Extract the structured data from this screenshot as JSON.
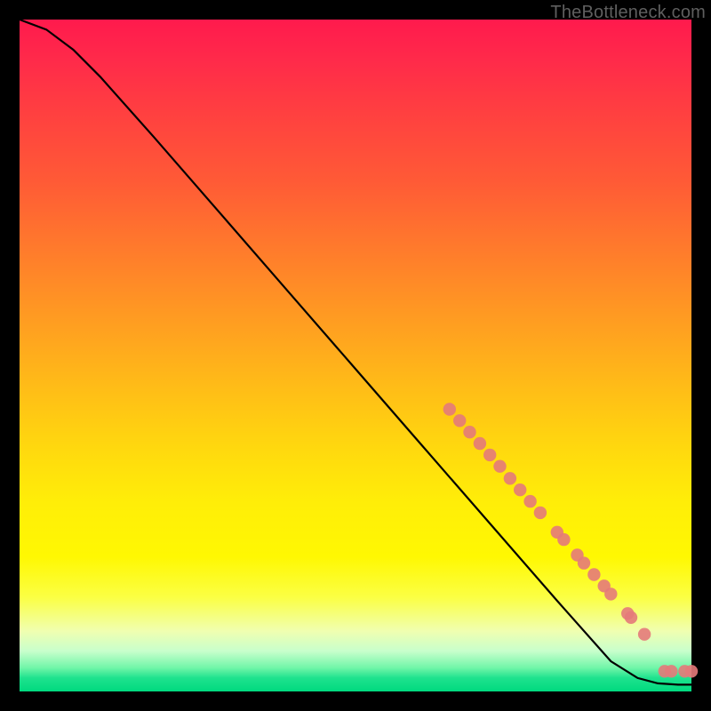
{
  "watermark": "TheBottleneck.com",
  "colors": {
    "curve_stroke": "#000000",
    "point_fill": "#e47a7a",
    "background": "#000000"
  },
  "chart_data": {
    "type": "line",
    "title": "",
    "xlabel": "",
    "ylabel": "",
    "xlim": [
      0,
      100
    ],
    "ylim": [
      0,
      100
    ],
    "grid": false,
    "legend": false,
    "curve": [
      {
        "x": 0,
        "y": 100
      },
      {
        "x": 4,
        "y": 98.5
      },
      {
        "x": 8,
        "y": 95.5
      },
      {
        "x": 12,
        "y": 91.5
      },
      {
        "x": 20,
        "y": 82.5
      },
      {
        "x": 30,
        "y": 71.0
      },
      {
        "x": 40,
        "y": 59.5
      },
      {
        "x": 50,
        "y": 48.0
      },
      {
        "x": 60,
        "y": 36.5
      },
      {
        "x": 70,
        "y": 25.0
      },
      {
        "x": 80,
        "y": 13.5
      },
      {
        "x": 88,
        "y": 4.5
      },
      {
        "x": 92,
        "y": 2.0
      },
      {
        "x": 95,
        "y": 1.2
      },
      {
        "x": 98,
        "y": 1.0
      },
      {
        "x": 100,
        "y": 1.0
      }
    ],
    "points": [
      {
        "x": 64.0,
        "y": 42.0
      },
      {
        "x": 65.5,
        "y": 40.3
      },
      {
        "x": 67.0,
        "y": 38.6
      },
      {
        "x": 68.5,
        "y": 36.9
      },
      {
        "x": 70.0,
        "y": 35.2
      },
      {
        "x": 71.5,
        "y": 33.5
      },
      {
        "x": 73.0,
        "y": 31.7
      },
      {
        "x": 74.5,
        "y": 30.0
      },
      {
        "x": 76.0,
        "y": 28.3
      },
      {
        "x": 77.5,
        "y": 26.6
      },
      {
        "x": 80.0,
        "y": 23.7
      },
      {
        "x": 81.0,
        "y": 22.6
      },
      {
        "x": 83.0,
        "y": 20.3
      },
      {
        "x": 84.0,
        "y": 19.1
      },
      {
        "x": 85.5,
        "y": 17.4
      },
      {
        "x": 87.0,
        "y": 15.7
      },
      {
        "x": 88.0,
        "y": 14.5
      },
      {
        "x": 90.5,
        "y": 11.6
      },
      {
        "x": 91.0,
        "y": 11.0
      },
      {
        "x": 93.0,
        "y": 8.5
      },
      {
        "x": 96.0,
        "y": 3.0
      },
      {
        "x": 97.0,
        "y": 3.0
      },
      {
        "x": 99.0,
        "y": 3.0
      },
      {
        "x": 100.0,
        "y": 3.0
      }
    ]
  }
}
